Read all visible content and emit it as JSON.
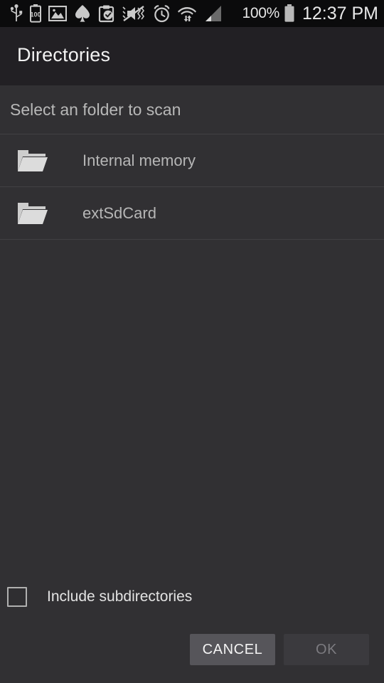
{
  "status_bar": {
    "icons": [
      {
        "name": "usb-icon",
        "label": "USB"
      },
      {
        "name": "battery-saver-icon",
        "label": "100"
      },
      {
        "name": "image-icon",
        "label": "Image"
      },
      {
        "name": "spade-icon",
        "label": "Spade"
      },
      {
        "name": "clipboard-check-icon",
        "label": "Clipboard"
      },
      {
        "name": "mute-vibrate-icon",
        "label": "Mute"
      },
      {
        "name": "alarm-clock-icon",
        "label": "Alarm"
      },
      {
        "name": "wifi-transfer-icon",
        "label": "Wi-Fi"
      },
      {
        "name": "cellular-signal-icon",
        "label": "Signal"
      }
    ],
    "battery_percent": "100%",
    "clock": "12:37 PM"
  },
  "header": {
    "title": "Directories"
  },
  "main": {
    "subtitle": "Select an folder to scan",
    "items": [
      {
        "label": "Internal memory",
        "icon": "folder-icon"
      },
      {
        "label": "extSdCard",
        "icon": "folder-icon"
      }
    ]
  },
  "footer": {
    "checkbox": {
      "label": "Include subdirectories",
      "checked": false
    },
    "buttons": {
      "cancel": "CANCEL",
      "ok": "OK",
      "ok_enabled": false
    }
  },
  "colors": {
    "statusbar_bg": "#0b0b0c",
    "titlebar_bg": "#222024",
    "body_bg": "#313033",
    "divider": "#414043",
    "title_text": "#f2f2f2",
    "subtitle_text": "#b8b8b8",
    "item_text": "#b6b6b6",
    "icon_fill": "#cdcdcd",
    "cancel_bg": "#56555a",
    "ok_bg": "#3b3a3e",
    "ok_text_disabled": "#7c7b80"
  }
}
